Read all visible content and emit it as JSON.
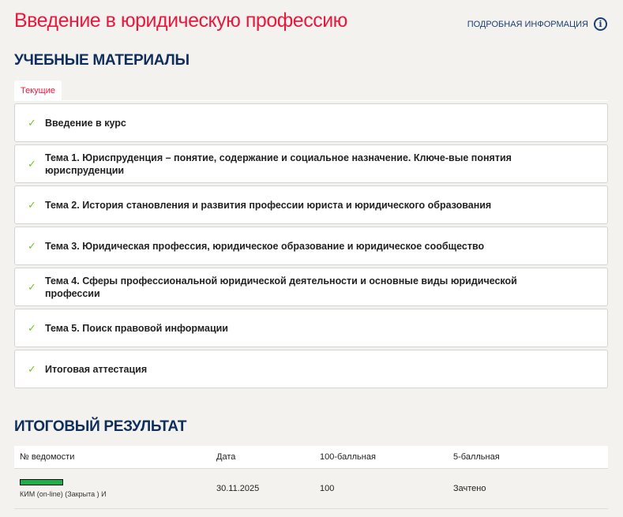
{
  "header": {
    "title": "Введение в юридическую профессию",
    "info_link": "ПОДРОБНАЯ ИНФОРМАЦИЯ"
  },
  "materials": {
    "heading": "УЧЕБНЫЕ МАТЕРИАЛЫ",
    "tab": "Текущие",
    "items": [
      {
        "label": "Введение в курс"
      },
      {
        "label": "Тема 1. Юриспруденция – понятие, содержание и социальное назначение. Ключе-вые понятия юриспруденции"
      },
      {
        "label": "Тема 2. История становления и развития профессии юриста и юридического образования"
      },
      {
        "label": "Тема 3. Юридическая профессия, юридическое образование и юридическое сообщество"
      },
      {
        "label": "Тема 4. Сферы профессиональной юридической деятельности и основные виды юридической профессии"
      },
      {
        "label": "Тема 5. Поиск правовой информации"
      },
      {
        "label": "Итоговая аттестация"
      }
    ]
  },
  "result": {
    "heading": "ИТОГОВЫЙ РЕЗУЛЬТАТ",
    "columns": [
      "№ ведомости",
      "Дата",
      "100-балльная",
      "5-балльная"
    ],
    "rows": [
      {
        "sheet": "КИМ (on-line) (Закрыта ) И",
        "progress": 1.0,
        "date": "30.11.2025",
        "score100": "100",
        "score5": "Зачтено"
      }
    ]
  },
  "colors": {
    "accent": "#e8193f",
    "heading": "#0f2e5c",
    "check": "#7cc12a",
    "progress": "#22ac4a"
  }
}
